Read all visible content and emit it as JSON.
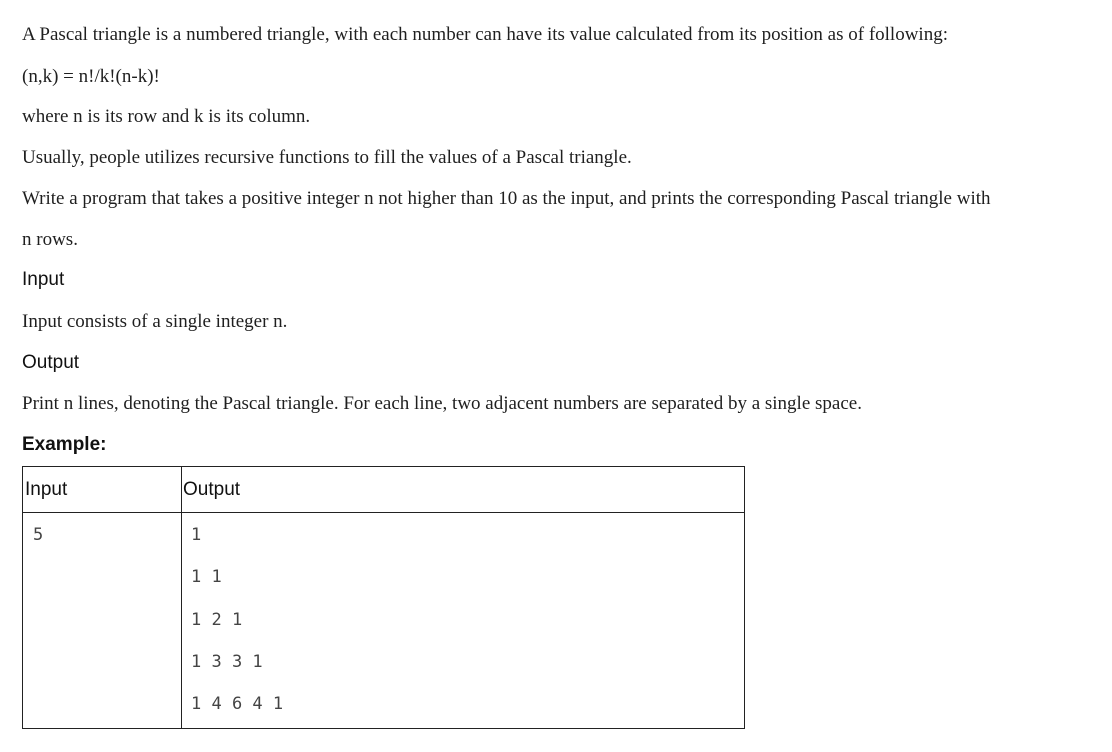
{
  "paragraphs": {
    "intro": "A Pascal triangle is a numbered triangle, with each number can have its value calculated from its position as of following:",
    "formula": "(n,k) = n!/k!(n-k)!",
    "where": "where n is its row and k is its column.",
    "usually": "Usually, people utilizes recursive functions to fill the values of a Pascal triangle.",
    "task_line1": "Write a program that takes a positive integer n not higher than 10 as the input, and prints the corresponding Pascal triangle with",
    "task_line2": "n rows."
  },
  "sections": {
    "input_heading": "Input",
    "input_text": "Input consists of a single integer n.",
    "output_heading": "Output",
    "output_text": "Print n lines, denoting the Pascal triangle. For each line, two adjacent numbers are separated by a single space.",
    "example_heading": "Example:"
  },
  "example_table": {
    "headers": [
      "Input",
      "Output"
    ],
    "input_value": "5",
    "output_lines": [
      "1",
      "1 1",
      "1 2 1",
      "1 3 3 1",
      "1 4 6 4 1"
    ]
  }
}
